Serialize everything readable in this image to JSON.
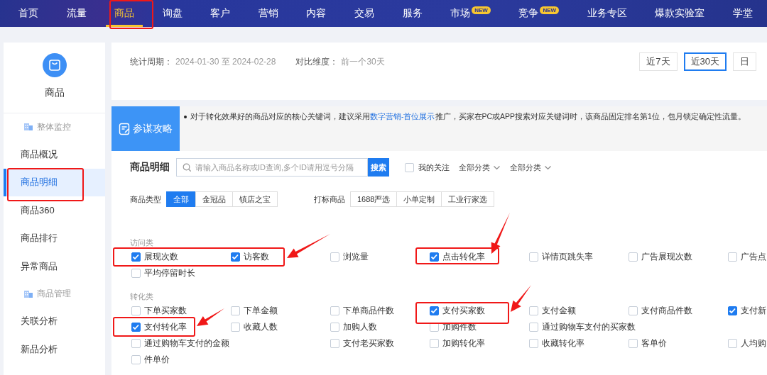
{
  "top_nav": [
    {
      "label": "首页",
      "selected": false
    },
    {
      "label": "流量",
      "selected": false
    },
    {
      "label": "商品",
      "selected": true
    },
    {
      "label": "询盘",
      "selected": false
    },
    {
      "label": "客户",
      "selected": false
    },
    {
      "label": "营销",
      "selected": false
    },
    {
      "label": "内容",
      "selected": false
    },
    {
      "label": "交易",
      "selected": false
    },
    {
      "label": "服务",
      "selected": false
    },
    {
      "label": "市场",
      "selected": false,
      "badge": "NEW"
    },
    {
      "label": "竞争",
      "selected": false,
      "badge": "NEW"
    },
    {
      "label": "业务专区",
      "selected": false
    },
    {
      "label": "爆款实验室",
      "selected": false
    },
    {
      "label": "学堂",
      "selected": false
    }
  ],
  "sidebar": {
    "title": "商品",
    "items": [
      {
        "kind": "group",
        "label": "整体监控"
      },
      {
        "kind": "link",
        "label": "商品概况",
        "selected": false
      },
      {
        "kind": "link",
        "label": "商品明细",
        "selected": true
      },
      {
        "kind": "link",
        "label": "商品360",
        "selected": false
      },
      {
        "kind": "link",
        "label": "商品排行",
        "selected": false
      },
      {
        "kind": "link",
        "label": "异常商品",
        "selected": false
      },
      {
        "kind": "group",
        "label": "商品管理"
      },
      {
        "kind": "link",
        "label": "关联分析",
        "selected": false
      },
      {
        "kind": "link",
        "label": "新品分析",
        "selected": false
      }
    ]
  },
  "period": {
    "label": "统计周期：",
    "value": "2024-01-30 至 2024-02-28",
    "compare_label": "对比维度：",
    "compare_value": "前一个30天"
  },
  "range_buttons": [
    {
      "label": "近7天",
      "selected": false
    },
    {
      "label": "近30天",
      "selected": true
    },
    {
      "label": "日",
      "selected": false
    }
  ],
  "tip": {
    "title": "参谋攻略",
    "before": "对于转化效果好的商品对应的核心关键词，建议采用",
    "link": "数字营销-首位展示",
    "after": "推广，买家在PC或APP搜索对应关键词时，该商品固定排名第1位，包月锁定确定性流量。"
  },
  "product_detail": {
    "title": "商品明细",
    "search": {
      "placeholder": "请输入商品名称或ID查询,多个ID请用逗号分隔",
      "button": "搜索"
    },
    "follow": {
      "label": "我的关注",
      "checked": false
    },
    "dropdowns": [
      "全部分类",
      "全部分类"
    ]
  },
  "filters": [
    {
      "label": "商品类型",
      "options": [
        {
          "label": "全部",
          "selected": true
        },
        {
          "label": "金冠品",
          "selected": false
        },
        {
          "label": "镇店之宝",
          "selected": false
        }
      ]
    },
    {
      "label": "打标商品",
      "options": [
        {
          "label": "1688严选",
          "selected": false
        },
        {
          "label": "小单定制",
          "selected": false
        },
        {
          "label": "工业行家选",
          "selected": false
        }
      ]
    }
  ],
  "metric_groups": [
    {
      "title": "访问类",
      "items": [
        {
          "label": "展现次数",
          "checked": true
        },
        {
          "label": "访客数",
          "checked": true
        },
        {
          "label": "浏览量",
          "checked": false
        },
        {
          "label": "点击转化率",
          "checked": true
        },
        {
          "label": "详情页跳失率",
          "checked": false
        },
        {
          "label": "广告展现次数",
          "checked": false
        },
        {
          "label": "广告点",
          "checked": false
        },
        {
          "label": "平均停留时长",
          "checked": false
        }
      ]
    },
    {
      "title": "转化类",
      "items": [
        {
          "label": "下单买家数",
          "checked": false
        },
        {
          "label": "下单金额",
          "checked": false
        },
        {
          "label": "下单商品件数",
          "checked": false
        },
        {
          "label": "支付买家数",
          "checked": true
        },
        {
          "label": "支付金额",
          "checked": false
        },
        {
          "label": "支付商品件数",
          "checked": false
        },
        {
          "label": "支付新",
          "checked": true
        },
        {
          "label": "支付转化率",
          "checked": true
        },
        {
          "label": "收藏人数",
          "checked": false
        },
        {
          "label": "加购人数",
          "checked": false
        },
        {
          "label": "加购件数",
          "checked": false
        },
        {
          "label": "通过购物车支付的买家数",
          "checked": false
        },
        {
          "label": "通过购物车支付的金额",
          "checked": false
        },
        {
          "label": "支付老买家数",
          "checked": false
        },
        {
          "label": "加购转化率",
          "checked": false
        },
        {
          "label": "收藏转化率",
          "checked": false
        },
        {
          "label": "客单价",
          "checked": false
        },
        {
          "label": "人均购",
          "checked": false
        },
        {
          "label": "件单价",
          "checked": false
        }
      ]
    }
  ]
}
